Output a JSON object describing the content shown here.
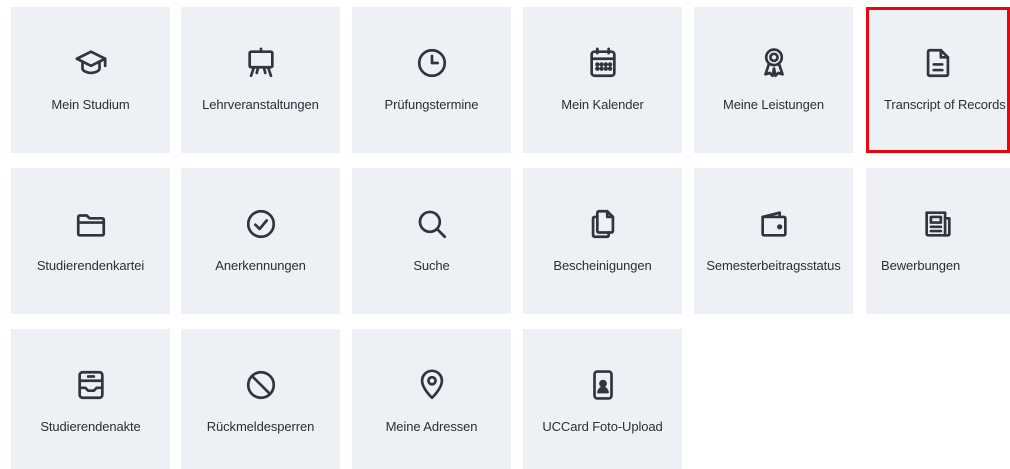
{
  "tiles": [
    {
      "label": "Mein Studium",
      "icon": "graduation-cap-icon"
    },
    {
      "label": "Lehrveranstaltungen",
      "icon": "easel-icon"
    },
    {
      "label": "Prüfungstermine",
      "icon": "clock-icon"
    },
    {
      "label": "Mein Kalender",
      "icon": "calendar-icon"
    },
    {
      "label": "Meine Leistungen",
      "icon": "award-ribbon-icon"
    },
    {
      "label": "Transcript of Records",
      "icon": "document-icon",
      "selected": true
    },
    {
      "label": "Studierendenkartei",
      "icon": "folder-icon"
    },
    {
      "label": "Anerkennungen",
      "icon": "check-circle-icon"
    },
    {
      "label": "Suche",
      "icon": "search-icon"
    },
    {
      "label": "Bescheinigungen",
      "icon": "documents-copy-icon"
    },
    {
      "label": "Semesterbeitragsstatus",
      "icon": "wallet-icon"
    },
    {
      "label": "Bewerbungen",
      "icon": "newspaper-icon"
    },
    {
      "label": "Studierendenakte",
      "icon": "inbox-tray-icon"
    },
    {
      "label": "Rückmeldesperren",
      "icon": "prohibited-icon"
    },
    {
      "label": "Meine Adressen",
      "icon": "map-pin-icon"
    },
    {
      "label": "UCCard Foto-Upload",
      "icon": "phone-photo-icon"
    }
  ],
  "colors": {
    "tile_background": "#edf0f5",
    "icon_stroke": "#2f3640",
    "label_text": "#2b2f36",
    "selection_border": "#e8070d"
  }
}
